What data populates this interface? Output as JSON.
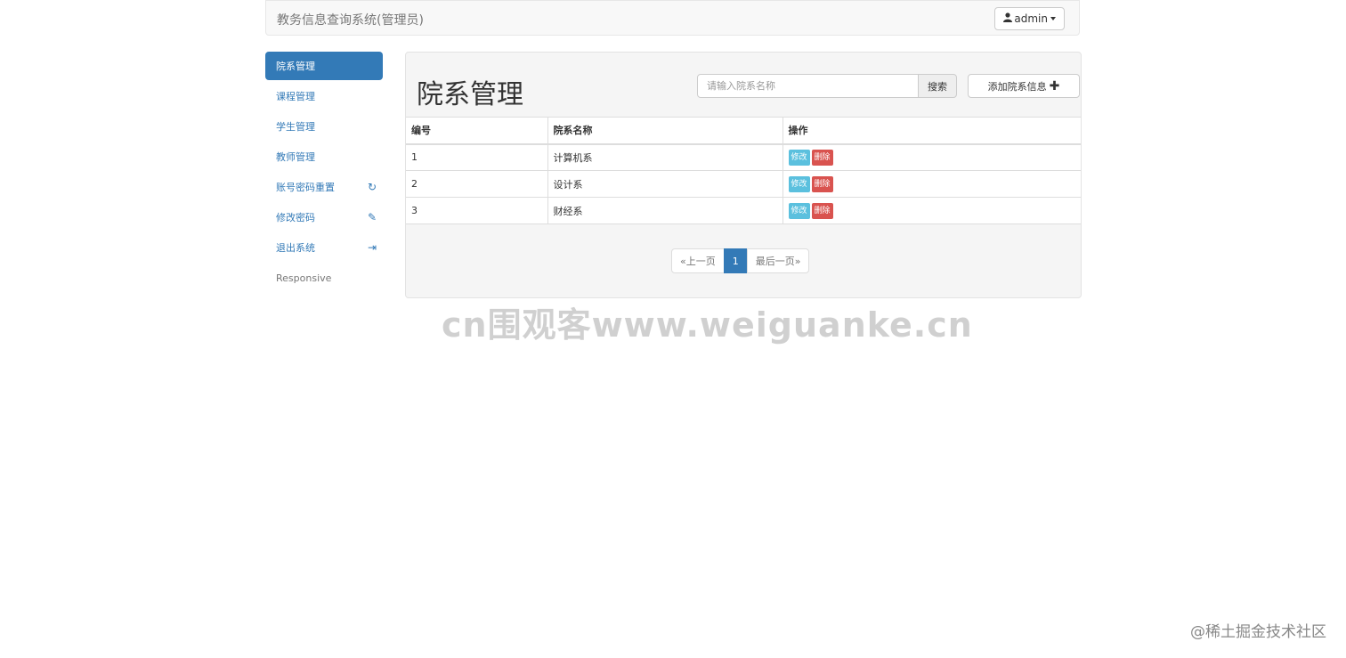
{
  "navbar": {
    "brand": "教务信息查询系统(管理员)",
    "user": "admin"
  },
  "sidebar": {
    "items": [
      {
        "label": "院系管理",
        "icon": ""
      },
      {
        "label": "课程管理",
        "icon": ""
      },
      {
        "label": "学生管理",
        "icon": ""
      },
      {
        "label": "教师管理",
        "icon": ""
      },
      {
        "label": "账号密码重置",
        "icon": "↻"
      },
      {
        "label": "修改密码",
        "icon": "✎"
      },
      {
        "label": "退出系统",
        "icon": "⇥"
      },
      {
        "label": "Responsive",
        "icon": ""
      }
    ]
  },
  "main": {
    "title": "院系管理",
    "search": {
      "placeholder": "请输入院系名称",
      "button": "搜索"
    },
    "add_button": "添加院系信息",
    "table": {
      "headers": [
        "编号",
        "院系名称",
        "操作"
      ],
      "rows": [
        {
          "id": "1",
          "name": "计算机系",
          "edit": "修改",
          "delete": "删除"
        },
        {
          "id": "2",
          "name": "设计系",
          "edit": "修改",
          "delete": "删除"
        },
        {
          "id": "3",
          "name": "财经系",
          "edit": "修改",
          "delete": "删除"
        }
      ]
    },
    "pagination": {
      "prev": "«上一页",
      "current": "1",
      "last": "最后一页»"
    }
  },
  "watermark": "cn围观客www.weiguanke.cn",
  "footer_mark": "@稀土掘金技术社区",
  "colors": {
    "primary": "#337ab7",
    "info": "#5bc0de",
    "danger": "#d9534f"
  }
}
